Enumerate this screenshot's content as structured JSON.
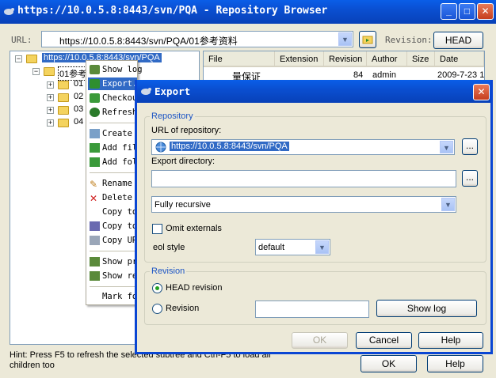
{
  "window": {
    "title": "https://10.0.5.8:8443/svn/PQA - Repository Browser"
  },
  "urlbar": {
    "label": "URL:",
    "value": "https://10.0.5.8:8443/svn/PQA/01参考资料",
    "revision_label": "Revision:",
    "head_button": "HEAD"
  },
  "tree": {
    "root": "https://10.0.5.8:8443/svn/PQA",
    "child": "01参考",
    "items": [
      "01",
      "02",
      "03",
      "04"
    ]
  },
  "list": {
    "columns": [
      "File",
      "Extension",
      "Revision",
      "Author",
      "Size",
      "Date"
    ],
    "row": {
      "file": "量保证",
      "revision": "84",
      "author": "admin",
      "date": "2009-7-23 1"
    }
  },
  "context_menu": {
    "items": [
      "Show log",
      "Export...",
      "Checkout",
      "Refresh",
      "Create",
      "Add fil",
      "Add fol",
      "Rename",
      "Delete",
      "Copy to",
      "Copy to",
      "Copy UR",
      "Show pr",
      "Show re",
      "Mark fo"
    ]
  },
  "hint": "Hint: Press F5 to refresh the selected subtree and Ctrl-F5 to load all children too",
  "main_buttons": {
    "ok": "OK",
    "help": "Help"
  },
  "dialog": {
    "title": "Export",
    "repository_group": "Repository",
    "url_label": "URL of repository:",
    "url_value": "https://10.0.5.8:8443/svn/PQA",
    "browse": "...",
    "export_dir_label": "Export directory:",
    "export_dir_value": "",
    "depth_value": "Fully recursive",
    "omit_externals": "Omit externals",
    "eol_label": "eol style",
    "eol_value": "default",
    "revision_group": "Revision",
    "head_revision": "HEAD revision",
    "revision": "Revision",
    "revision_value": "",
    "show_log": "Show log",
    "ok": "OK",
    "cancel": "Cancel",
    "help": "Help"
  },
  "colors": {
    "titlebar": "#0a4fd1",
    "selection": "#316ac5",
    "face": "#ece9d8"
  }
}
